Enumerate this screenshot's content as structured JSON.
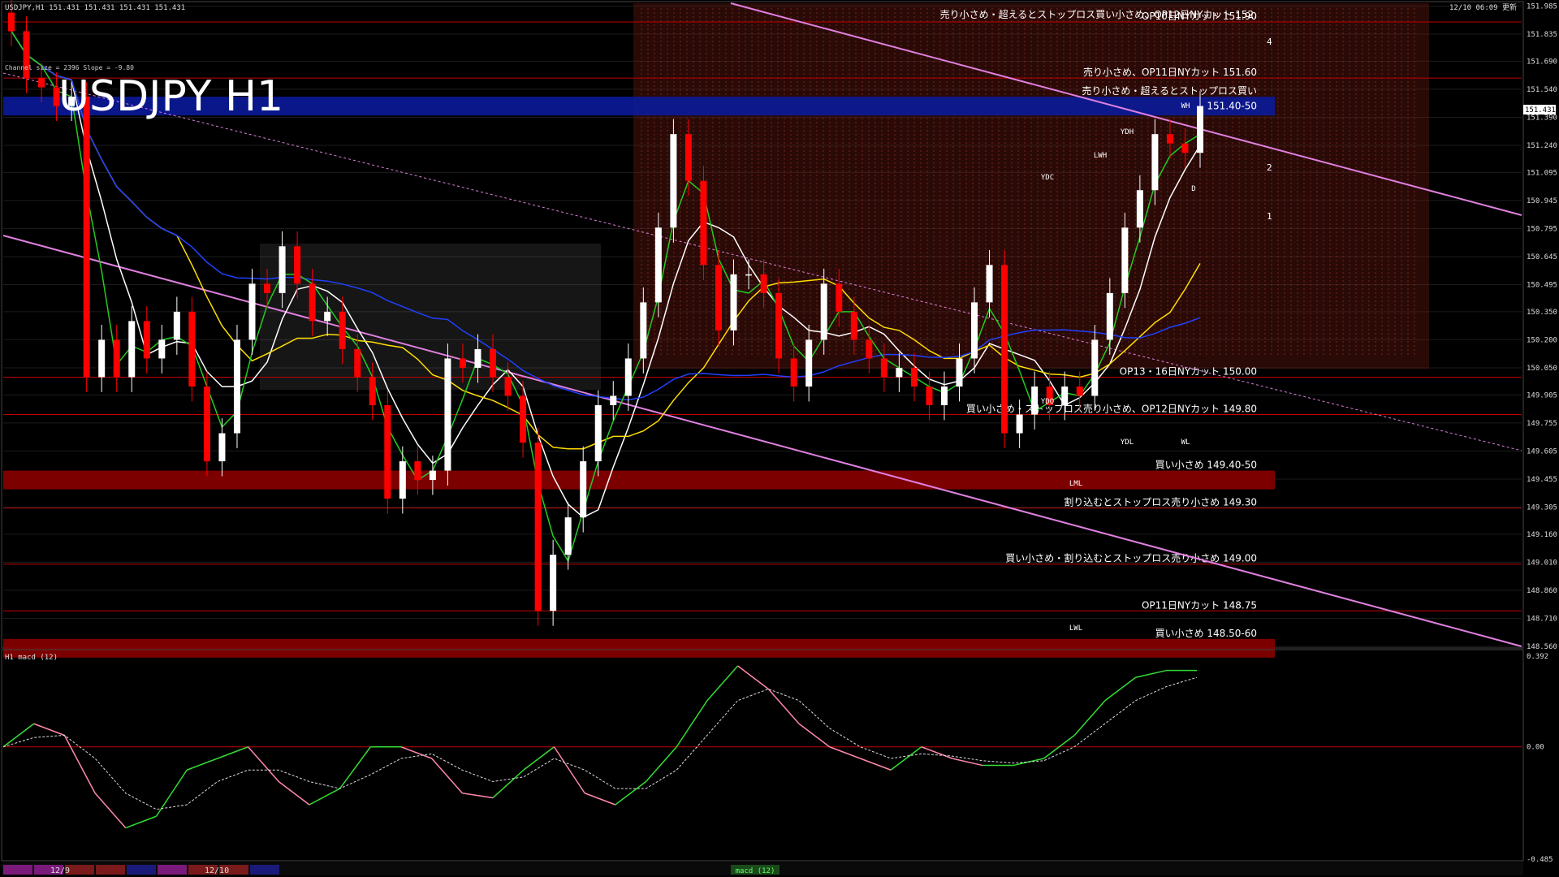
{
  "window": {
    "header": "USDJPY,H1  151.431 151.431 151.431 151.431",
    "timestamp": "12/10 06:09 更新",
    "indicator_line": "Channel size = 2396 Slope = -9.80",
    "watermark": "USDJPY H1"
  },
  "colors": {
    "background": "#000000",
    "bull_candle": "#ffffff",
    "bear_candle": "#ff0000",
    "support_band": "#8b0000",
    "resistance_band": "#0a1a9a",
    "channel": "#e080e0",
    "level_line": "#c00000",
    "grid": "#2a2a2a",
    "axis_text": "#dddddd",
    "macd_up": "#33dd33",
    "macd_down": "#ff88aa"
  },
  "chart_data": [
    {
      "type": "candlestick",
      "title": "USDJPY H1",
      "ylim": [
        148.56,
        152.0
      ],
      "y_ticks": [
        "151.985",
        "151.835",
        "151.690",
        "151.540",
        "151.390",
        "151.240",
        "151.095",
        "150.945",
        "150.795",
        "150.645",
        "150.495",
        "150.350",
        "150.200",
        "150.050",
        "149.905",
        "149.755",
        "149.605",
        "149.455",
        "149.305",
        "149.160",
        "149.010",
        "148.860",
        "148.710",
        "148.560"
      ],
      "current_price": "151.431",
      "x_labels": [
        "12/9",
        "12/10"
      ],
      "close": [
        151.85,
        151.6,
        151.55,
        151.45,
        151.5,
        150.0,
        150.2,
        150.0,
        150.3,
        150.1,
        150.2,
        150.35,
        149.95,
        149.55,
        149.7,
        150.2,
        150.5,
        150.45,
        150.7,
        150.5,
        150.3,
        150.35,
        150.15,
        150.0,
        149.85,
        149.35,
        149.55,
        149.45,
        149.5,
        150.1,
        150.05,
        150.15,
        150.0,
        149.9,
        149.65,
        148.75,
        149.05,
        149.25,
        149.55,
        149.85,
        149.9,
        150.1,
        150.4,
        150.8,
        151.3,
        151.05,
        150.6,
        150.25,
        150.55,
        150.55,
        150.45,
        150.1,
        149.95,
        150.2,
        150.5,
        150.35,
        150.2,
        150.1,
        150.0,
        150.05,
        149.95,
        149.85,
        149.95,
        150.1,
        150.4,
        150.6,
        149.7,
        149.8,
        149.95,
        149.85,
        149.95,
        149.9,
        150.2,
        150.45,
        150.8,
        151.0,
        151.3,
        151.25,
        151.2,
        151.45
      ],
      "levels": [
        {
          "price": "151.90",
          "label": "OP10日NYカット 151.90"
        },
        {
          "price": "151.60",
          "label": "売り小さめ、OP11日NYカット 151.60"
        },
        {
          "price": "151.40-50",
          "label": "売り小さめ・超えるとストップロス買い",
          "band": true
        },
        {
          "price": "150.00",
          "label": "OP13・16日NYカット 150.00"
        },
        {
          "price": "149.80",
          "label": "買い小さめ・ストップロス売り小さめ、OP12日NYカット 149.80"
        },
        {
          "price": "149.40-50",
          "label": "買い小さめ 149.40-50",
          "band": true
        },
        {
          "price": "149.30",
          "label": "割り込むとストップロス売り小さめ 149.30"
        },
        {
          "price": "149.00",
          "label": "買い小さめ・割り込むとストップロス売り小さめ 149.00"
        },
        {
          "price": "148.75",
          "label": "OP11日NYカット 148.75"
        },
        {
          "price": "148.50-60",
          "label": "買い小さめ 148.50-60",
          "band": true
        }
      ],
      "top_label": "売り小さめ・超えるとストップロス買い小さめ、OP12日NYカット 152.",
      "band_upper_value": "151.40-50",
      "markers": [
        "YDC",
        "YDH",
        "YDL",
        "YDO",
        "LWH",
        "LWL",
        "LML",
        "WH",
        "WL",
        "D"
      ],
      "projection_labels": [
        "4",
        "2",
        "1"
      ]
    },
    {
      "type": "line",
      "title": "H1  macd (12)",
      "ylim": [
        -0.485,
        0.392
      ],
      "y_ticks": [
        "0.392",
        "0.00",
        "-0.485"
      ],
      "series": [
        {
          "values": [
            0.0,
            0.1,
            0.05,
            -0.2,
            -0.35,
            -0.3,
            -0.1,
            -0.05,
            0.0,
            -0.15,
            -0.25,
            -0.18,
            0.0,
            0.0,
            -0.05,
            -0.2,
            -0.22,
            -0.1,
            0.0,
            -0.2,
            -0.25,
            -0.15,
            0.0,
            0.2,
            0.35,
            0.25,
            0.1,
            0.0,
            -0.05,
            -0.1,
            0.0,
            -0.05,
            -0.08,
            -0.08,
            -0.05,
            0.05,
            0.2,
            0.3,
            0.33,
            0.33
          ]
        },
        {
          "values": [
            0.0,
            0.04,
            0.05,
            -0.05,
            -0.2,
            -0.27,
            -0.25,
            -0.15,
            -0.1,
            -0.1,
            -0.15,
            -0.18,
            -0.12,
            -0.05,
            -0.03,
            -0.1,
            -0.15,
            -0.13,
            -0.05,
            -0.1,
            -0.18,
            -0.18,
            -0.1,
            0.05,
            0.2,
            0.25,
            0.2,
            0.08,
            0.0,
            -0.05,
            -0.03,
            -0.04,
            -0.06,
            -0.07,
            -0.06,
            0.0,
            0.1,
            0.2,
            0.26,
            0.3
          ]
        }
      ]
    }
  ],
  "footer": {
    "label_macd": "macd (12)"
  }
}
